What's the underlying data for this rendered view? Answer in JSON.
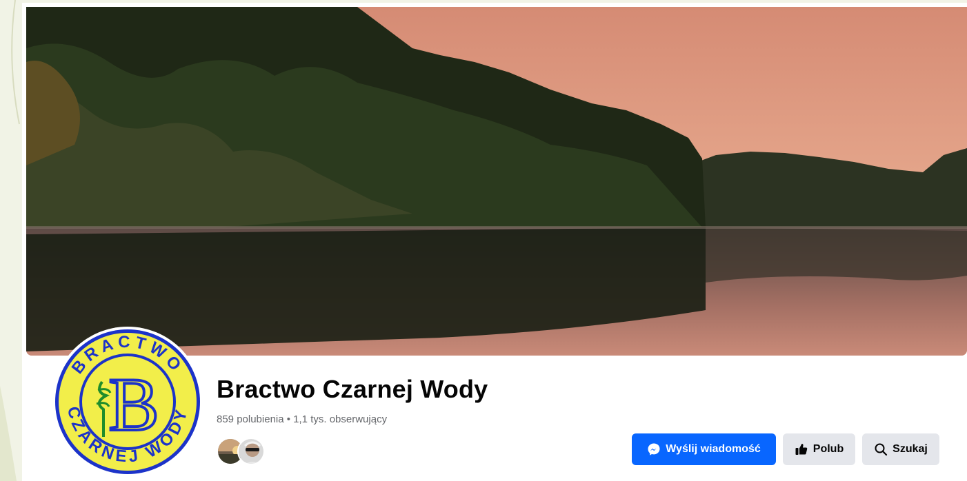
{
  "page": {
    "name": "Bractwo Czarnej Wody",
    "stats": "859 polubienia • 1,1 tys. obserwujący"
  },
  "logo": {
    "top_text": "BRACTWO",
    "bottom_text": "CZARNEJ WODY",
    "monogram": "B"
  },
  "actions": {
    "message_label": "Wyślij wiadomość",
    "like_label": "Polub",
    "search_label": "Szukaj"
  },
  "icons": {
    "message": "messenger-icon",
    "like": "thumbs-up-icon",
    "search": "search-icon"
  },
  "colors": {
    "primary": "#0866ff",
    "secondary": "#e4e6eb",
    "logo_yellow": "#f2ee4a",
    "logo_blue": "#1c33c9",
    "logo_green": "#1f8d2b"
  }
}
